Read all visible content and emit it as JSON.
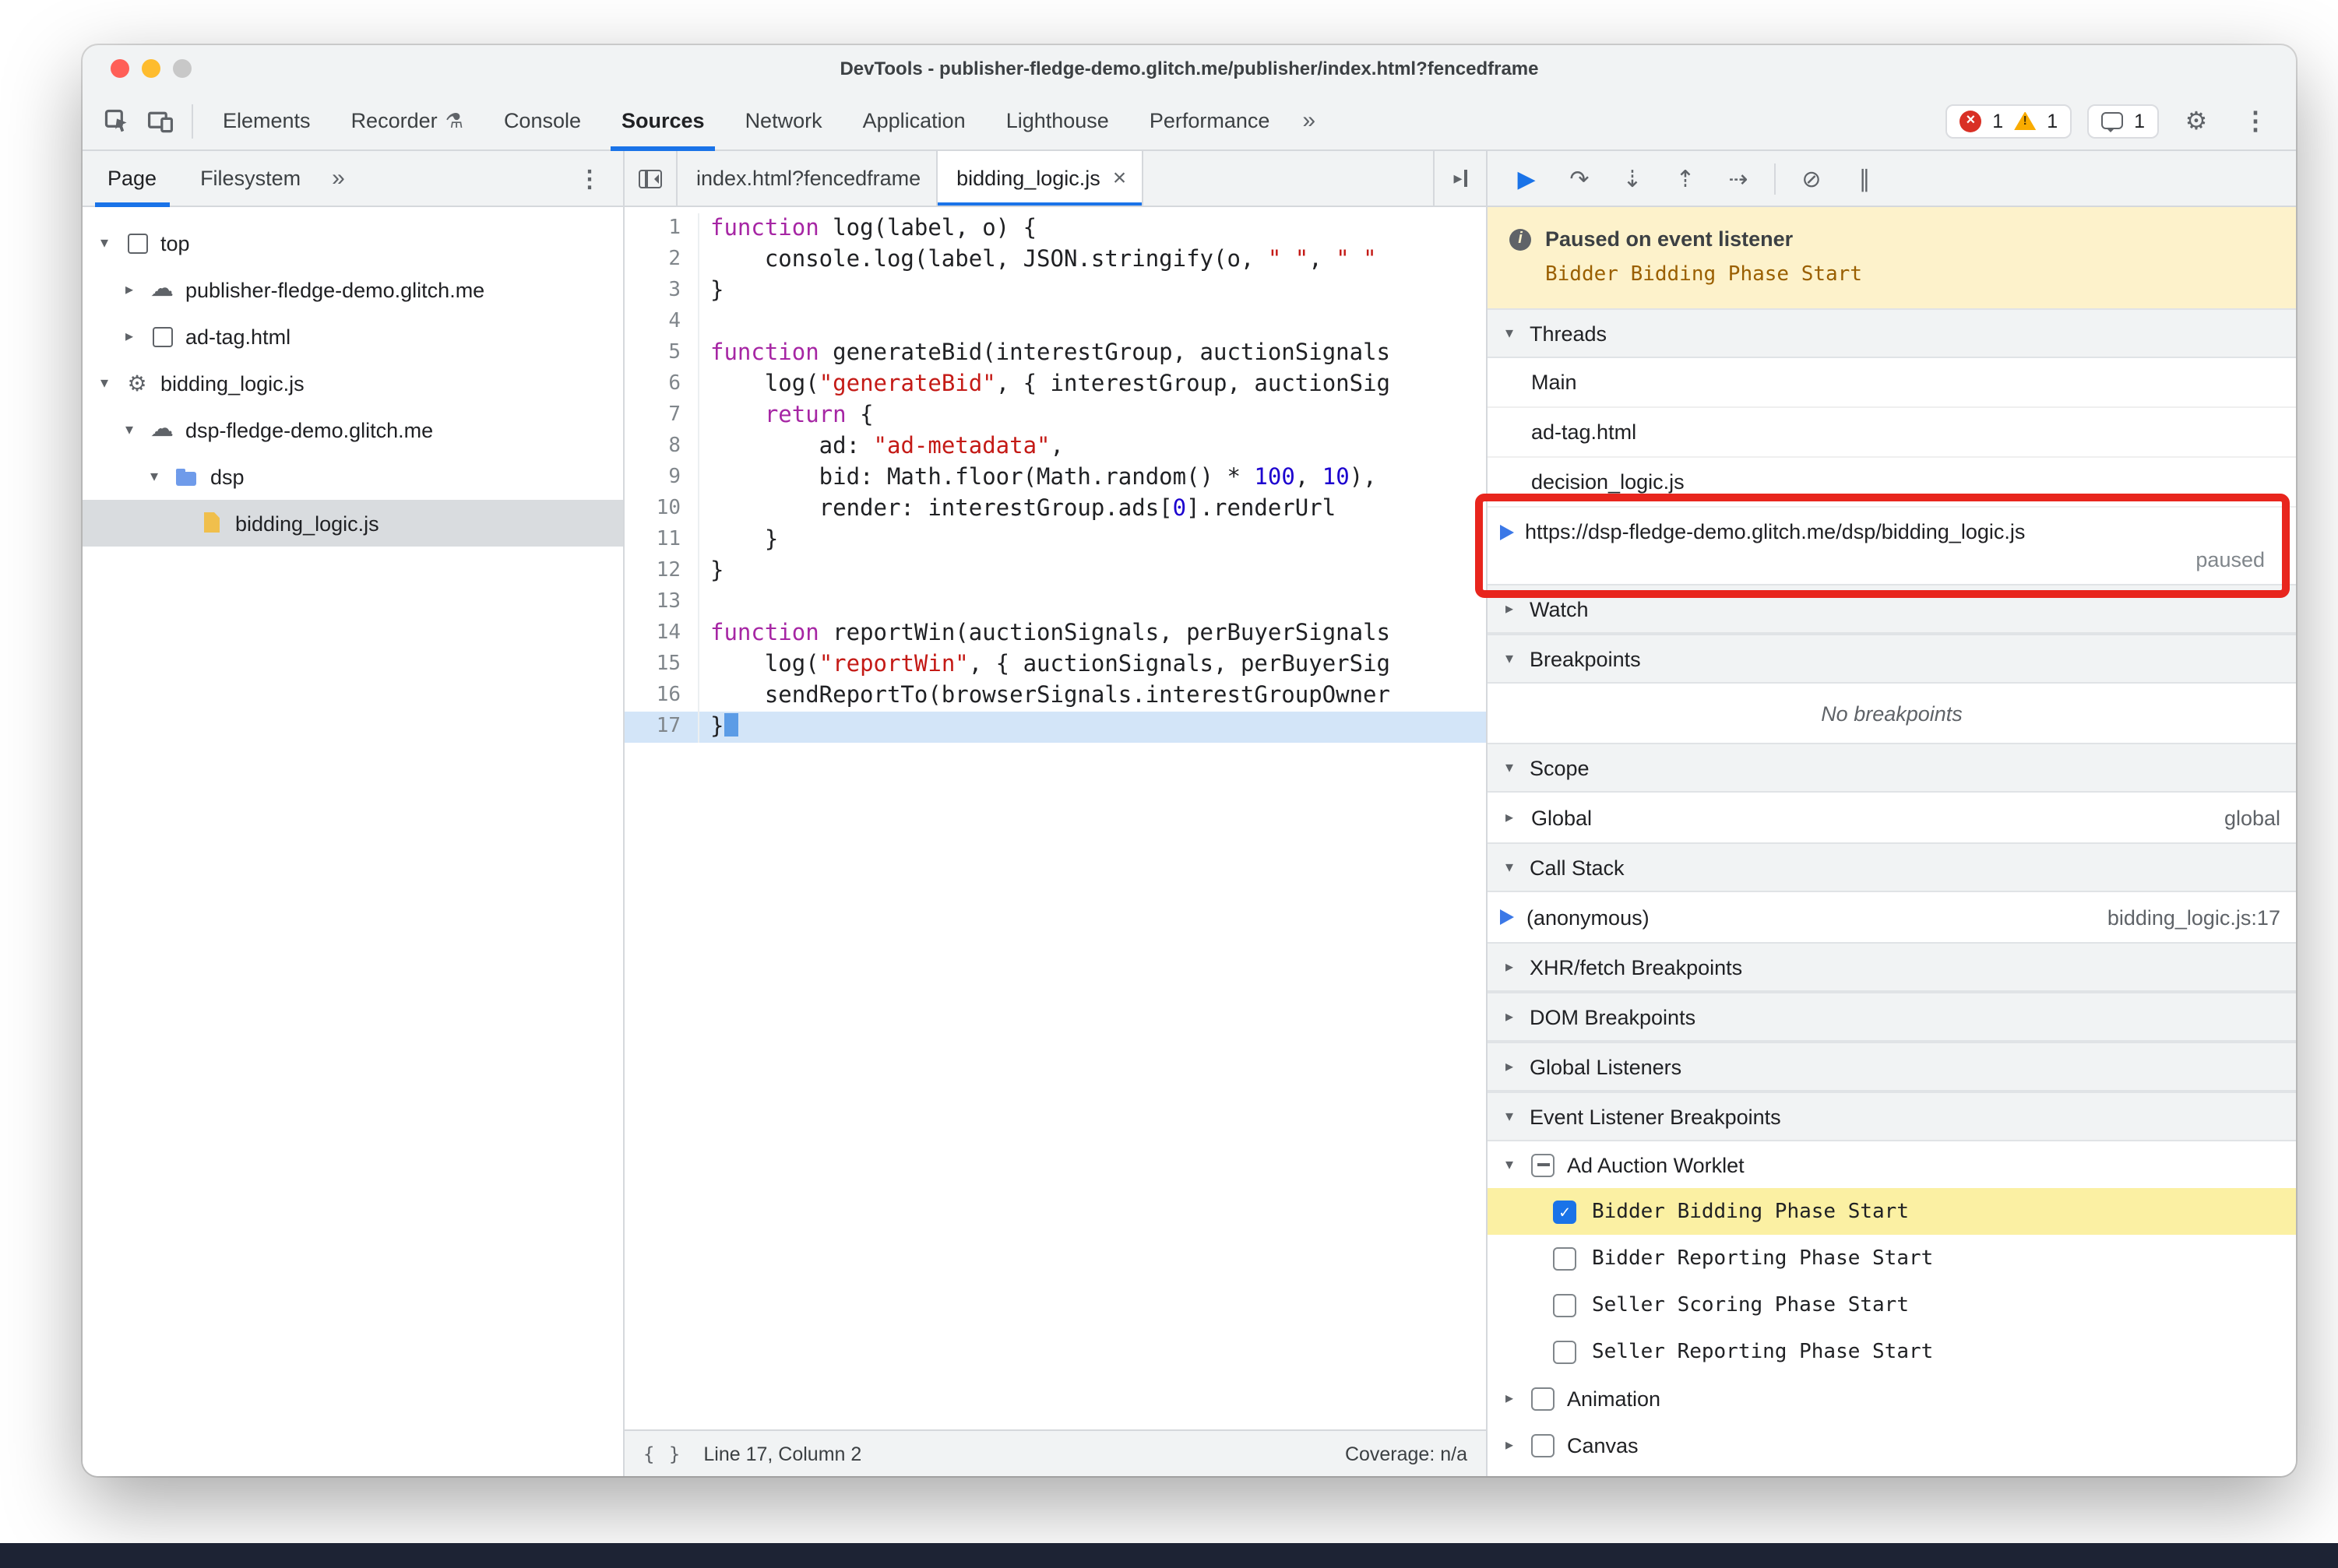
{
  "window": {
    "title": "DevTools - publisher-fledge-demo.glitch.me/publisher/index.html?fencedframe"
  },
  "toolbar": {
    "tabs": [
      {
        "label": "Elements"
      },
      {
        "label": "Recorder",
        "icon": "experiment-flask-icon"
      },
      {
        "label": "Console"
      },
      {
        "label": "Sources"
      },
      {
        "label": "Network"
      },
      {
        "label": "Application"
      },
      {
        "label": "Lighthouse"
      },
      {
        "label": "Performance"
      }
    ],
    "active_tab": "Sources",
    "overflow_label": "»",
    "error_count": "1",
    "warning_count": "1",
    "issue_count": "1"
  },
  "navigator": {
    "tabs": [
      {
        "label": "Page",
        "active": true
      },
      {
        "label": "Filesystem",
        "active": false
      }
    ],
    "overflow_label": "»",
    "tree": [
      {
        "label": "top",
        "icon": "frame-icon",
        "arrow": "down",
        "indent": 0,
        "selected": false
      },
      {
        "label": "publisher-fledge-demo.glitch.me",
        "icon": "cloud-icon",
        "arrow": "right",
        "indent": 1,
        "selected": false
      },
      {
        "label": "ad-tag.html",
        "icon": "frame-icon",
        "arrow": "right",
        "indent": 1,
        "selected": false
      },
      {
        "label": "bidding_logic.js",
        "icon": "gear-icon",
        "arrow": "down",
        "indent": 0,
        "selected": false
      },
      {
        "label": "dsp-fledge-demo.glitch.me",
        "icon": "cloud-icon",
        "arrow": "down",
        "indent": 1,
        "selected": false
      },
      {
        "label": "dsp",
        "icon": "folder-icon",
        "arrow": "down",
        "indent": 2,
        "selected": false
      },
      {
        "label": "bidding_logic.js",
        "icon": "file-icon",
        "arrow": "none",
        "indent": 3,
        "selected": true
      }
    ]
  },
  "editor": {
    "tabs": [
      {
        "label": "index.html?fencedframe",
        "active": false,
        "closable": false
      },
      {
        "label": "bidding_logic.js",
        "active": true,
        "closable": true
      }
    ],
    "paused_line": 17,
    "code": {
      "lines": [
        {
          "n": 1,
          "segs": [
            [
              "k",
              "function"
            ],
            [
              "p",
              " log(label, o) {"
            ]
          ]
        },
        {
          "n": 2,
          "segs": [
            [
              "p",
              "    console.log(label, JSON.stringify(o, "
            ],
            [
              "s",
              "\" \""
            ],
            [
              "p",
              ", "
            ],
            [
              "s",
              "\" \""
            ]
          ]
        },
        {
          "n": 3,
          "segs": [
            [
              "p",
              "}"
            ]
          ]
        },
        {
          "n": 4,
          "segs": []
        },
        {
          "n": 5,
          "segs": [
            [
              "k",
              "function"
            ],
            [
              "p",
              " generateBid(interestGroup, auctionSignals"
            ]
          ]
        },
        {
          "n": 6,
          "segs": [
            [
              "p",
              "    log("
            ],
            [
              "s",
              "\"generateBid\""
            ],
            [
              "p",
              ", { interestGroup, auctionSig"
            ]
          ]
        },
        {
          "n": 7,
          "segs": [
            [
              "p",
              "    "
            ],
            [
              "k",
              "return"
            ],
            [
              "p",
              " {"
            ]
          ]
        },
        {
          "n": 8,
          "segs": [
            [
              "p",
              "        ad: "
            ],
            [
              "s",
              "\"ad-metadata\""
            ],
            [
              "p",
              ","
            ]
          ]
        },
        {
          "n": 9,
          "segs": [
            [
              "p",
              "        bid: Math.floor(Math.random() * "
            ],
            [
              "n2",
              "100"
            ],
            [
              "p",
              ", "
            ],
            [
              "n2",
              "10"
            ],
            [
              "p",
              "),"
            ]
          ]
        },
        {
          "n": 10,
          "segs": [
            [
              "p",
              "        render: interestGroup.ads["
            ],
            [
              "n2",
              "0"
            ],
            [
              "p",
              "].renderUrl"
            ]
          ]
        },
        {
          "n": 11,
          "segs": [
            [
              "p",
              "    }"
            ]
          ]
        },
        {
          "n": 12,
          "segs": [
            [
              "p",
              "}"
            ]
          ]
        },
        {
          "n": 13,
          "segs": []
        },
        {
          "n": 14,
          "segs": [
            [
              "k",
              "function"
            ],
            [
              "p",
              " reportWin(auctionSignals, perBuyerSignals"
            ]
          ]
        },
        {
          "n": 15,
          "segs": [
            [
              "p",
              "    log("
            ],
            [
              "s",
              "\"reportWin\""
            ],
            [
              "p",
              ", { auctionSignals, perBuyerSig"
            ]
          ]
        },
        {
          "n": 16,
          "segs": [
            [
              "p",
              "    sendReportTo(browserSignals.interestGroupOwner"
            ]
          ]
        },
        {
          "n": 17,
          "segs": [
            [
              "p",
              "}"
            ]
          ],
          "cursor": true
        }
      ]
    },
    "status": {
      "braces": "{ }",
      "position": "Line 17, Column 2",
      "coverage": "Coverage: n/a"
    }
  },
  "debugger": {
    "toolbar_icons": [
      {
        "name": "resume-icon",
        "glyph": "▶",
        "accent": true
      },
      {
        "name": "step-over-icon",
        "glyph": "↷"
      },
      {
        "name": "step-into-icon",
        "glyph": "⇣"
      },
      {
        "name": "step-out-icon",
        "glyph": "⇡"
      },
      {
        "name": "step-icon",
        "glyph": "⇢"
      },
      {
        "name": "deactivate-breakpoints-icon",
        "glyph": "⊘"
      },
      {
        "name": "pause-on-exceptions-icon",
        "glyph": "∥"
      }
    ],
    "paused_banner": {
      "title": "Paused on event listener",
      "subtitle": "Bidder Bidding Phase Start"
    },
    "threads": {
      "title": "Threads",
      "expanded": true,
      "items": [
        {
          "label": "Main",
          "active": false
        },
        {
          "label": "ad-tag.html",
          "active": false
        },
        {
          "label": "decision_logic.js",
          "active": false
        },
        {
          "label": "https://dsp-fledge-demo.glitch.me/dsp/bidding_logic.js",
          "active": true,
          "status": "paused"
        }
      ]
    },
    "watch": {
      "title": "Watch",
      "expanded": false
    },
    "breakpoints": {
      "title": "Breakpoints",
      "expanded": true,
      "empty_text": "No breakpoints"
    },
    "scope": {
      "title": "Scope",
      "expanded": true,
      "rows": [
        {
          "label": "Global",
          "right": "global"
        }
      ]
    },
    "call_stack": {
      "title": "Call Stack",
      "expanded": true,
      "rows": [
        {
          "label": "(anonymous)",
          "right": "bidding_logic.js:17",
          "active": true
        }
      ]
    },
    "xhr_breakpoints": {
      "title": "XHR/fetch Breakpoints",
      "expanded": false
    },
    "dom_breakpoints": {
      "title": "DOM Breakpoints",
      "expanded": false
    },
    "global_listeners": {
      "title": "Global Listeners",
      "expanded": false
    },
    "event_listener_breakpoints": {
      "title": "Event Listener Breakpoints",
      "expanded": true,
      "groups": [
        {
          "label": "Ad Auction Worklet",
          "checkbox": "indeterminate",
          "expanded": true,
          "children": [
            {
              "label": "Bidder Bidding Phase Start",
              "checked": true,
              "highlighted": true
            },
            {
              "label": "Bidder Reporting Phase Start",
              "checked": false,
              "highlighted": false
            },
            {
              "label": "Seller Scoring Phase Start",
              "checked": false,
              "highlighted": false
            },
            {
              "label": "Seller Reporting Phase Start",
              "checked": false,
              "highlighted": false
            }
          ]
        },
        {
          "label": "Animation",
          "checkbox": "unchecked",
          "expanded": false,
          "children": []
        },
        {
          "label": "Canvas",
          "checkbox": "unchecked",
          "expanded": false,
          "children": []
        }
      ]
    }
  },
  "colors": {
    "accent_blue": "#1a73e8",
    "annotation_red": "#e8251d",
    "selection_gray": "#d9dcdf",
    "paused_banner_bg": "#fdf2cb",
    "paused_line_blue": "#d3e5f8",
    "listener_highlight_yellow": "#fbf0a3",
    "error_red": "#d93025",
    "warning_yellow": "#f9ab00",
    "keyword_color": "#a626a4",
    "string_color": "#c41a16",
    "number_color": "#1c00cf"
  }
}
